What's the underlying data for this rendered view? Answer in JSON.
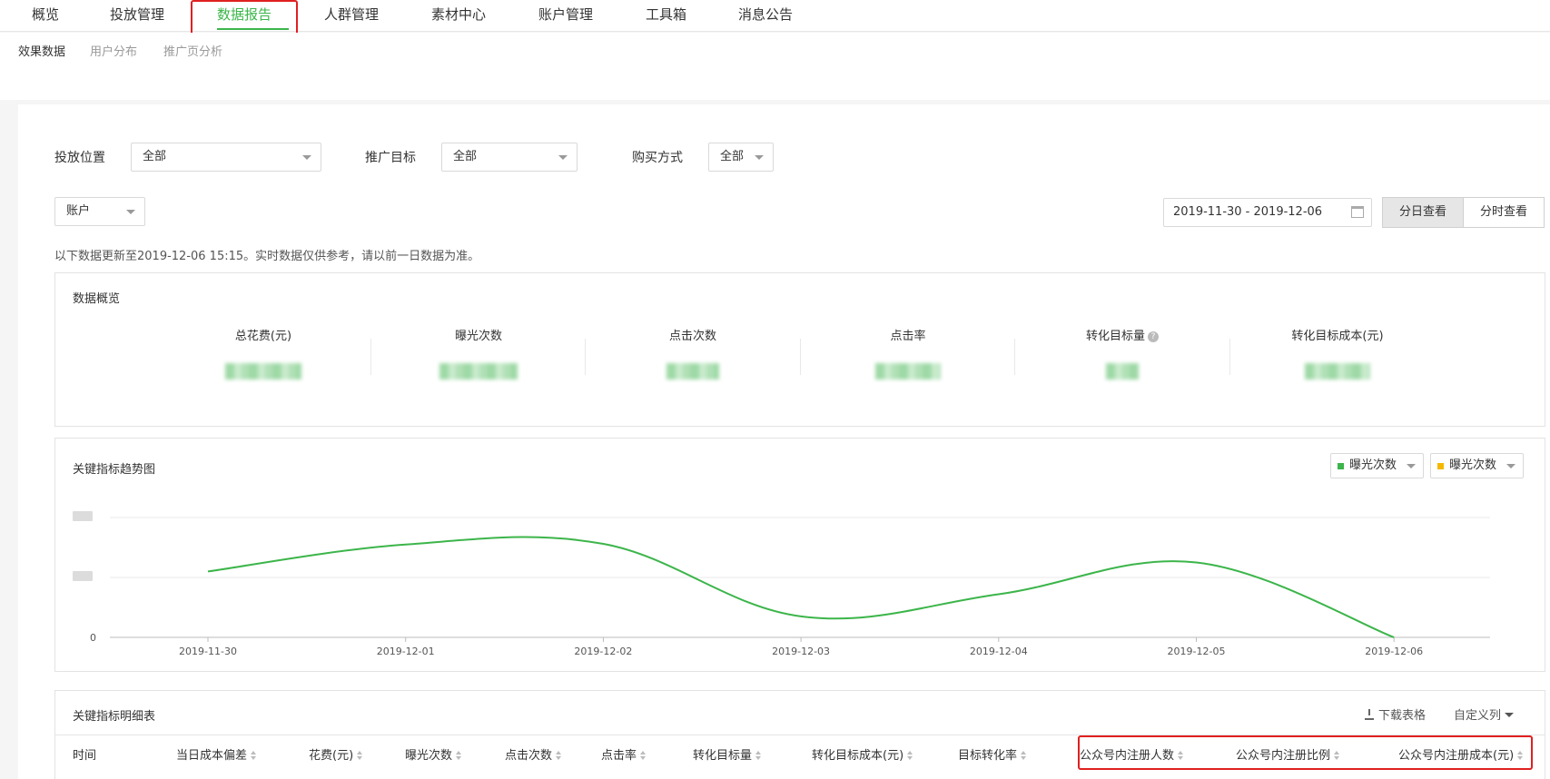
{
  "top_nav": {
    "items": [
      "概览",
      "投放管理",
      "数据报告",
      "人群管理",
      "素材中心",
      "账户管理",
      "工具箱",
      "消息公告"
    ],
    "active": "数据报告"
  },
  "sub_nav": {
    "items": [
      "效果数据",
      "用户分布",
      "推广页分析"
    ],
    "active": "效果数据"
  },
  "filters": {
    "placement_label": "投放位置",
    "placement_value": "全部",
    "goal_label": "推广目标",
    "goal_value": "全部",
    "purchase_label": "购买方式",
    "purchase_value": "全部",
    "level_value": "账户"
  },
  "date_range": "2019-11-30 - 2019-12-06",
  "view_buttons": [
    "分日查看",
    "分时查看"
  ],
  "notice": "以下数据更新至2019-12-06 15:15。实时数据仅供参考，请以前一日数据为准。",
  "overview": {
    "title": "数据概览",
    "metrics": [
      "总花费(元)",
      "曝光次数",
      "点击次数",
      "点击率",
      "转化目标量",
      "转化目标成本(元)"
    ]
  },
  "trend": {
    "title": "关键指标趋势图",
    "legend_selects": [
      {
        "label": "曝光次数",
        "color": "#3cb54a"
      },
      {
        "label": "曝光次数",
        "color": "#f5b800"
      }
    ]
  },
  "chart_data": {
    "type": "line",
    "x": [
      "2019-11-30",
      "2019-12-01",
      "2019-12-02",
      "2019-12-03",
      "2019-12-04",
      "2019-12-05",
      "2019-12-06"
    ],
    "series": [
      {
        "values": [
          1.1,
          1.55,
          1.56,
          0.35,
          0.72,
          1.25,
          0.0
        ],
        "color": "#3cb54a"
      }
    ],
    "y_tick_labels": [
      "0"
    ],
    "ylim": [
      0,
      2
    ]
  },
  "detail_table": {
    "title": "关键指标明细表",
    "download_label": "下载表格",
    "custom_columns_label": "自定义列",
    "columns": [
      "时间",
      "当日成本偏差",
      "花费(元)",
      "曝光次数",
      "点击次数",
      "点击率",
      "转化目标量",
      "转化目标成本(元)",
      "目标转化率",
      "公众号内注册人数",
      "公众号内注册比例",
      "公众号内注册成本(元)"
    ]
  }
}
